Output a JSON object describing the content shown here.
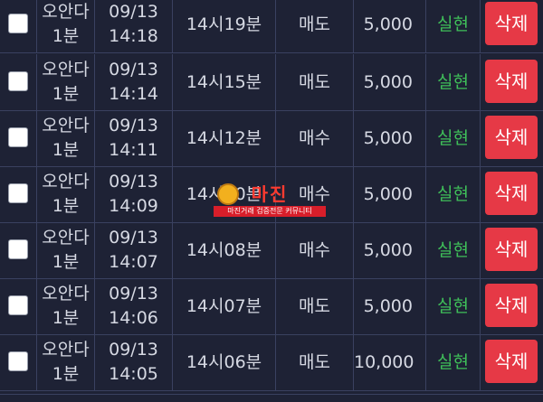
{
  "rows": [
    {
      "game_l1": "오안다",
      "game_l2": "1분",
      "date": "09/13",
      "time": "14:18",
      "round": "14시19분",
      "pick": "매도",
      "amount": "5,000",
      "status": "실현",
      "delete_label": "삭제"
    },
    {
      "game_l1": "오안다",
      "game_l2": "1분",
      "date": "09/13",
      "time": "14:14",
      "round": "14시15분",
      "pick": "매도",
      "amount": "5,000",
      "status": "실현",
      "delete_label": "삭제"
    },
    {
      "game_l1": "오안다",
      "game_l2": "1분",
      "date": "09/13",
      "time": "14:11",
      "round": "14시12분",
      "pick": "매수",
      "amount": "5,000",
      "status": "실현",
      "delete_label": "삭제"
    },
    {
      "game_l1": "오안다",
      "game_l2": "1분",
      "date": "09/13",
      "time": "14:09",
      "round": "14시10분",
      "pick": "매수",
      "amount": "5,000",
      "status": "실현",
      "delete_label": "삭제"
    },
    {
      "game_l1": "오안다",
      "game_l2": "1분",
      "date": "09/13",
      "time": "14:07",
      "round": "14시08분",
      "pick": "매수",
      "amount": "5,000",
      "status": "실현",
      "delete_label": "삭제"
    },
    {
      "game_l1": "오안다",
      "game_l2": "1분",
      "date": "09/13",
      "time": "14:06",
      "round": "14시07분",
      "pick": "매도",
      "amount": "5,000",
      "status": "실현",
      "delete_label": "삭제"
    },
    {
      "game_l1": "오안다",
      "game_l2": "1분",
      "date": "09/13",
      "time": "14:05",
      "round": "14시06분",
      "pick": "매도",
      "amount": "10,000",
      "status": "실현",
      "delete_label": "삭제"
    }
  ],
  "watermark": {
    "logo_text": "마진",
    "subtitle": "마진거래 검증전문 커뮤니티"
  },
  "colors": {
    "background": "#1e2235",
    "status_green": "#3fbf59",
    "delete_red": "#e63946"
  }
}
